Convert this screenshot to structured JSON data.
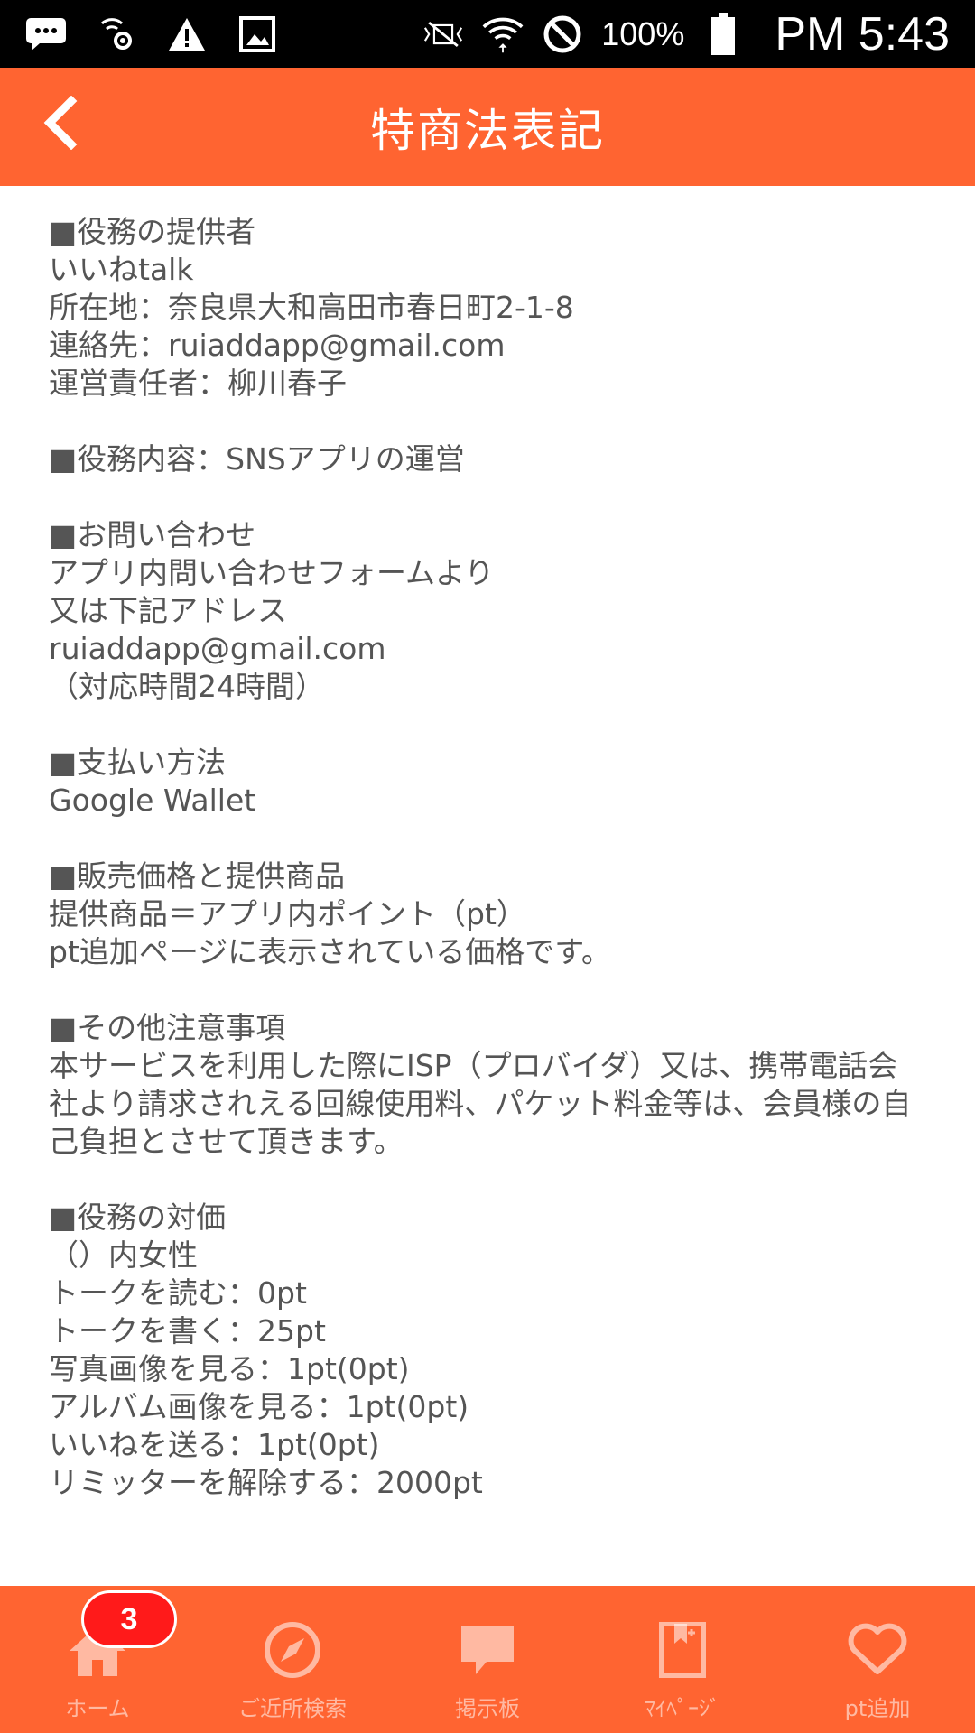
{
  "status_bar": {
    "battery_text": "100%",
    "time": "PM 5:43",
    "icons": [
      "messages-icon",
      "location-settings-icon",
      "warning-icon",
      "image-icon",
      "mute-icon",
      "wifi-icon",
      "do-not-disturb-icon",
      "battery-icon"
    ]
  },
  "header": {
    "title": "特商法表記",
    "back_icon": "chevron-left-icon"
  },
  "sections": [
    {
      "lines": [
        "■役務の提供者",
        "いいねtalk",
        "所在地：奈良県大和高田市春日町2-1-8",
        "連絡先：ruiaddapp@gmail.com",
        "運営責任者：柳川春子"
      ]
    },
    {
      "lines": [
        "■役務内容：SNSアプリの運営"
      ]
    },
    {
      "lines": [
        "■お問い合わせ",
        "アプリ内問い合わせフォームより",
        "又は下記アドレス",
        "ruiaddapp@gmail.com",
        "（対応時間24時間）"
      ]
    },
    {
      "lines": [
        "■支払い方法",
        "Google Wallet"
      ]
    },
    {
      "lines": [
        "■販売価格と提供商品",
        "提供商品＝アプリ内ポイント（pt）",
        "pt追加ページに表示されている価格です。"
      ]
    },
    {
      "lines": [
        "■その他注意事項",
        "本サービスを利用した際にISP（プロバイダ）又は、携帯電話会社より請求されえる回線使用料、パケット料金等は、会員様の自己負担とさせて頂きます。"
      ]
    },
    {
      "lines": [
        "■役務の対価",
        "（）内女性",
        "トークを読む：0pt",
        "トークを書く：25pt",
        "写真画像を見る：1pt(0pt)",
        "アルバム画像を見る：1pt(0pt)",
        "いいねを送る：1pt(0pt)",
        "リミッターを解除する：2000pt"
      ]
    }
  ],
  "tabs": [
    {
      "label": "ホーム",
      "icon": "home-icon",
      "badge": "3"
    },
    {
      "label": "ご近所検索",
      "icon": "compass-icon"
    },
    {
      "label": "掲示板",
      "icon": "chat-bubble-icon"
    },
    {
      "label": "ﾏｲﾍﾟｰｼﾞ",
      "icon": "bookmark-book-icon"
    },
    {
      "label": "pt追加",
      "icon": "heart-icon"
    }
  ],
  "colors": {
    "accent": "#ff6431",
    "badge": "#ff1a1a",
    "text": "#555555"
  }
}
